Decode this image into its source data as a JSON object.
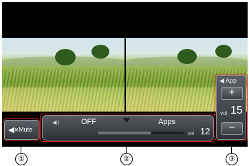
{
  "volume_panel": {
    "app_label": "App",
    "plus": "+",
    "minus": "−",
    "vol_label": "vol",
    "vol_value": "15"
  },
  "mute": {
    "label": "Mute"
  },
  "source_bar": {
    "left_option": "OFF",
    "right_option": "Apps",
    "vol_label": "vol",
    "vol_value": "12",
    "slider_fraction": 0.62
  },
  "callouts": [
    "①",
    "②",
    "③"
  ]
}
